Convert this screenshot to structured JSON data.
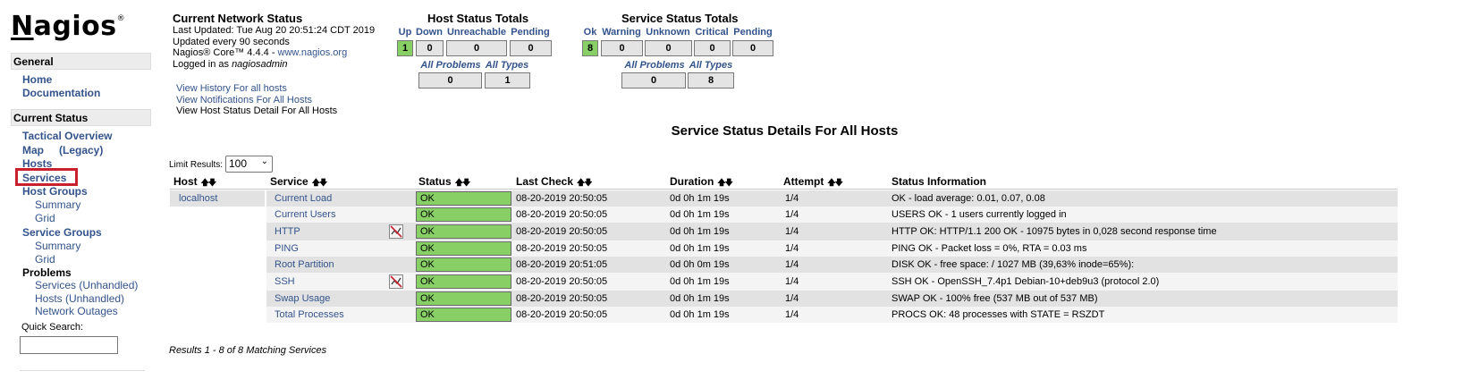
{
  "sidebar": {
    "logo": "Nagios",
    "logo_mark": "®",
    "general": {
      "title": "General",
      "items": [
        "Home",
        "Documentation"
      ]
    },
    "current_status": {
      "title": "Current Status",
      "tactical_overview": "Tactical Overview",
      "map": "Map",
      "map_legacy": "(Legacy)",
      "hosts": "Hosts",
      "services": "Services",
      "host_groups": "Host Groups",
      "host_groups_summary": "Summary",
      "host_groups_grid": "Grid",
      "service_groups": "Service Groups",
      "service_groups_summary": "Summary",
      "service_groups_grid": "Grid",
      "problems": "Problems",
      "problems_services": "Services (Unhandled)",
      "problems_hosts": "Hosts (Unhandled)",
      "problems_outages": "Network Outages"
    },
    "quick_search": {
      "label": "Quick Search:",
      "value": ""
    }
  },
  "info": {
    "title": "Current Network Status",
    "last_updated": "Last Updated: Tue Aug 20 20:51:24 CDT 2019",
    "update_interval": "Updated every 90 seconds",
    "version_prefix": "Nagios® Core™ 4.4.4 - ",
    "version_link": "www.nagios.org",
    "logged_in_prefix": "Logged in as ",
    "logged_in_user": "nagiosadmin",
    "links": [
      "View History For all hosts",
      "View Notifications For All Hosts",
      "View Host Status Detail For All Hosts"
    ]
  },
  "host_totals": {
    "title": "Host Status Totals",
    "headers": [
      "Up",
      "Down",
      "Unreachable",
      "Pending"
    ],
    "values": [
      "1",
      "0",
      "0",
      "0"
    ],
    "sub_headers": [
      "All Problems",
      "All Types"
    ],
    "sub_values": [
      "0",
      "1"
    ]
  },
  "service_totals": {
    "title": "Service Status Totals",
    "headers": [
      "Ok",
      "Warning",
      "Unknown",
      "Critical",
      "Pending"
    ],
    "values": [
      "8",
      "0",
      "0",
      "0",
      "0"
    ],
    "sub_headers": [
      "All Problems",
      "All Types"
    ],
    "sub_values": [
      "0",
      "8"
    ]
  },
  "main": {
    "title": "Service Status Details For All Hosts",
    "limit_label": "Limit Results:",
    "limit_value": "100",
    "columns": [
      "Host",
      "Service",
      "Status",
      "Last Check",
      "Duration",
      "Attempt",
      "Status Information"
    ],
    "host": "localhost",
    "rows": [
      {
        "service": "Current Load",
        "status": "OK",
        "last_check": "08-20-2019 20:50:05",
        "duration": "0d 0h 1m 19s",
        "attempt": "1/4",
        "info": "OK - load average: 0.01, 0.07, 0.08"
      },
      {
        "service": "Current Users",
        "status": "OK",
        "last_check": "08-20-2019 20:50:05",
        "duration": "0d 0h 1m 19s",
        "attempt": "1/4",
        "info": "USERS OK - 1 users currently logged in"
      },
      {
        "service": "HTTP",
        "status": "OK",
        "last_check": "08-20-2019 20:50:05",
        "duration": "0d 0h 1m 19s",
        "attempt": "1/4",
        "info": "HTTP OK: HTTP/1.1 200 OK - 10975 bytes in 0,028 second response time"
      },
      {
        "service": "PING",
        "status": "OK",
        "last_check": "08-20-2019 20:50:05",
        "duration": "0d 0h 1m 19s",
        "attempt": "1/4",
        "info": "PING OK - Packet loss = 0%, RTA = 0.03 ms"
      },
      {
        "service": "Root Partition",
        "status": "OK",
        "last_check": "08-20-2019 20:51:05",
        "duration": "0d 0h 0m 19s",
        "attempt": "1/4",
        "info": "DISK OK - free space: / 1027 MB (39,63% inode=65%):"
      },
      {
        "service": "SSH",
        "status": "OK",
        "last_check": "08-20-2019 20:50:05",
        "duration": "0d 0h 1m 19s",
        "attempt": "1/4",
        "info": "SSH OK - OpenSSH_7.4p1 Debian-10+deb9u3 (protocol 2.0)"
      },
      {
        "service": "Swap Usage",
        "status": "OK",
        "last_check": "08-20-2019 20:50:05",
        "duration": "0d 0h 1m 19s",
        "attempt": "1/4",
        "info": "SWAP OK - 100% free (537 MB out of 537 MB)"
      },
      {
        "service": "Total Processes",
        "status": "OK",
        "last_check": "08-20-2019 20:50:05",
        "duration": "0d 0h 1m 19s",
        "attempt": "1/4",
        "info": "PROCS OK: 48 processes with STATE = RSZDT"
      }
    ],
    "results": "Results 1 - 8 of 8 Matching Services"
  },
  "colors": {
    "ok_green": "#88d066",
    "link_blue": "#33538c",
    "highlight_red": "#c8202c"
  }
}
